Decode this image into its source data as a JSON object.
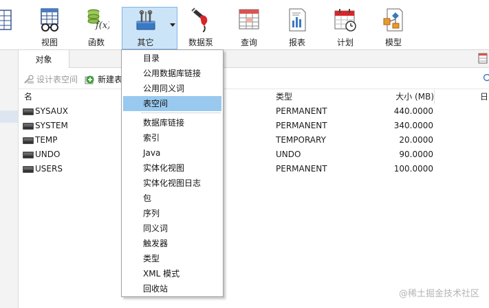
{
  "toolbar": {
    "items": [
      {
        "label": "视图",
        "icon": "view-table-glasses-icon"
      },
      {
        "label": "函数",
        "icon": "function-icon"
      },
      {
        "label": "其它",
        "icon": "tools-icon"
      },
      {
        "label": "数据泵",
        "icon": "data-pump-icon"
      },
      {
        "label": "查询",
        "icon": "query-icon"
      },
      {
        "label": "报表",
        "icon": "report-icon"
      },
      {
        "label": "计划",
        "icon": "schedule-calendar-icon"
      },
      {
        "label": "模型",
        "icon": "model-diagram-icon"
      }
    ]
  },
  "tabs": {
    "objects": "对象"
  },
  "object_toolbar": {
    "design": "设计表空间",
    "new": "新建表"
  },
  "table": {
    "headers": {
      "name": "名",
      "type": "类型",
      "size": "大小 (MB)",
      "extra": "日"
    },
    "rows": [
      {
        "name": "SYSAUX",
        "type": "PERMANENT",
        "size": "440.0000"
      },
      {
        "name": "SYSTEM",
        "type": "PERMANENT",
        "size": "340.0000"
      },
      {
        "name": "TEMP",
        "type": "TEMPORARY",
        "size": "20.0000"
      },
      {
        "name": "UNDO",
        "type": "UNDO",
        "size": "90.0000"
      },
      {
        "name": "USERS",
        "type": "PERMANENT",
        "size": "100.0000"
      }
    ]
  },
  "menu": {
    "items": [
      "目录",
      "公用数据库链接",
      "公用同义词",
      "表空间",
      "数据库链接",
      "索引",
      "Java",
      "实体化视图",
      "实体化视图日志",
      "包",
      "序列",
      "同义词",
      "触发器",
      "类型",
      "XML 模式",
      "回收站"
    ],
    "highlighted": "表空间"
  },
  "watermark": "@稀土掘金技术社区",
  "colors": {
    "accent": "#cce4f7",
    "menu_highlight": "#99c9ef",
    "icon_blue": "#3a78c2"
  }
}
